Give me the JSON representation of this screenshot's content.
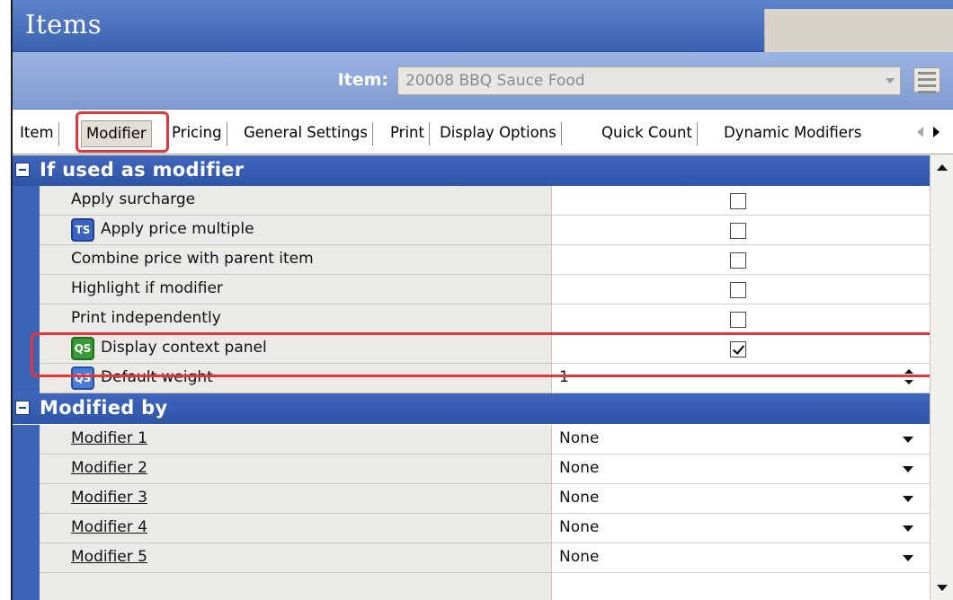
{
  "window": {
    "title": "Items"
  },
  "item_selector": {
    "label": "Item:",
    "value": "20008 BBQ Sauce Food"
  },
  "tabs": [
    {
      "label": "Item"
    },
    {
      "label": "Modifier",
      "active": true
    },
    {
      "label": "Pricing"
    },
    {
      "label": "General Settings"
    },
    {
      "label": "Print"
    },
    {
      "label": "Display Options"
    },
    {
      "label": "Quick Count"
    },
    {
      "label": "Dynamic Modifiers"
    }
  ],
  "sections": {
    "used_as_modifier": {
      "title": "If used as modifier",
      "rows": [
        {
          "label": "Apply surcharge",
          "checked": false
        },
        {
          "label": "Apply price multiple",
          "icon": "ts-icon",
          "icon_text": "TS",
          "checked": false
        },
        {
          "label": "Combine price with parent item",
          "checked": false
        },
        {
          "label": "Highlight if modifier",
          "checked": false
        },
        {
          "label": "Print independently",
          "checked": false
        },
        {
          "label": "Display context panel",
          "icon": "qs-icon",
          "icon_text": "QS",
          "checked": true
        },
        {
          "label": "Default weight",
          "icon": "qs-icon",
          "icon_text": "QS",
          "value": "1"
        }
      ]
    },
    "modified_by": {
      "title": "Modified by",
      "rows": [
        {
          "label": "Modifier 1",
          "value": "None"
        },
        {
          "label": "Modifier 2",
          "value": "None"
        },
        {
          "label": "Modifier 3",
          "value": "None"
        },
        {
          "label": "Modifier 4",
          "value": "None"
        },
        {
          "label": "Modifier 5",
          "value": "None"
        }
      ]
    }
  },
  "colors": {
    "highlight": "#e3363b",
    "section_header": "#3f66bb",
    "title_bar": "#4a71bd"
  }
}
